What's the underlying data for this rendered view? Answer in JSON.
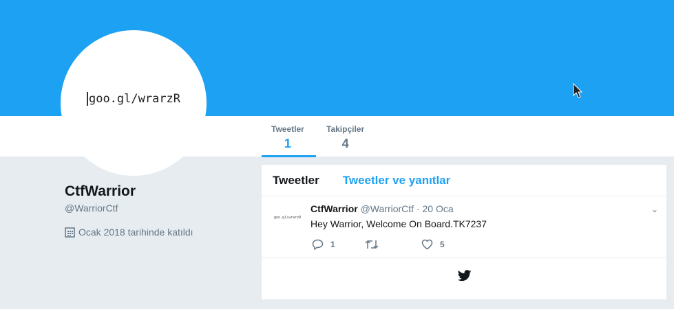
{
  "banner_color": "#1da1f2",
  "avatar_text": "goo.gl/wrarzR",
  "nav": {
    "tabs": [
      {
        "label": "Tweetler",
        "count": "1"
      },
      {
        "label": "Takipçiler",
        "count": "4"
      }
    ]
  },
  "profile": {
    "name": "CtfWarrior",
    "handle": "@WarriorCtf",
    "joined": "Ocak 2018 tarihinde katıldı"
  },
  "timeline": {
    "tabs": [
      "Tweetler",
      "Tweetler ve yanıtlar"
    ],
    "tweets": [
      {
        "avatar_text": "goo.gl/wrarzR",
        "name": "CtfWarrior",
        "handle": "@WarriorCtf",
        "date": "· 20 Oca",
        "text": "Hey Warrior, Welcome On Board.TK7237",
        "replies": "1",
        "retweets": "",
        "likes": "5"
      }
    ]
  }
}
